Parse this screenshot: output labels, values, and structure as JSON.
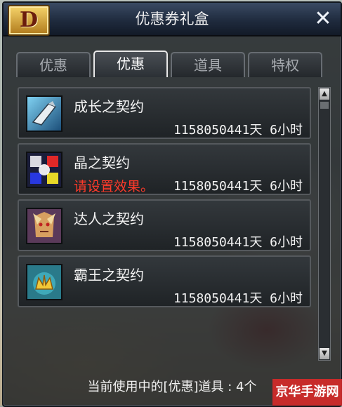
{
  "window": {
    "title": "优惠券礼盒",
    "logo_letter": "D",
    "close_label": "✕"
  },
  "tabs": [
    {
      "label": "优惠",
      "active": false
    },
    {
      "label": "优惠",
      "active": true
    },
    {
      "label": "道具",
      "active": false
    },
    {
      "label": "特权",
      "active": false
    }
  ],
  "items": [
    {
      "name": "成长之契约",
      "subtitle": "",
      "duration": "1158050441天 6小时",
      "icon": "growth-contract-icon"
    },
    {
      "name": "晶之契约",
      "subtitle": "请设置效果。",
      "duration": "1158050441天 6小时",
      "icon": "crystal-contract-icon"
    },
    {
      "name": "达人之契约",
      "subtitle": "",
      "duration": "1158050441天 6小时",
      "icon": "expert-contract-icon"
    },
    {
      "name": "霸王之契约",
      "subtitle": "",
      "duration": "1158050441天 6小时",
      "icon": "overlord-contract-icon"
    }
  ],
  "scrollbar": {
    "up": "▲",
    "down": "▼"
  },
  "footer": "当前使用中的[优惠]道具 : 4个",
  "watermark": "京华手游网",
  "colors": {
    "warning_text": "#ff3a2a",
    "active_tab_border": "#e8e8e8",
    "titlebar": "#1f2b3e"
  }
}
